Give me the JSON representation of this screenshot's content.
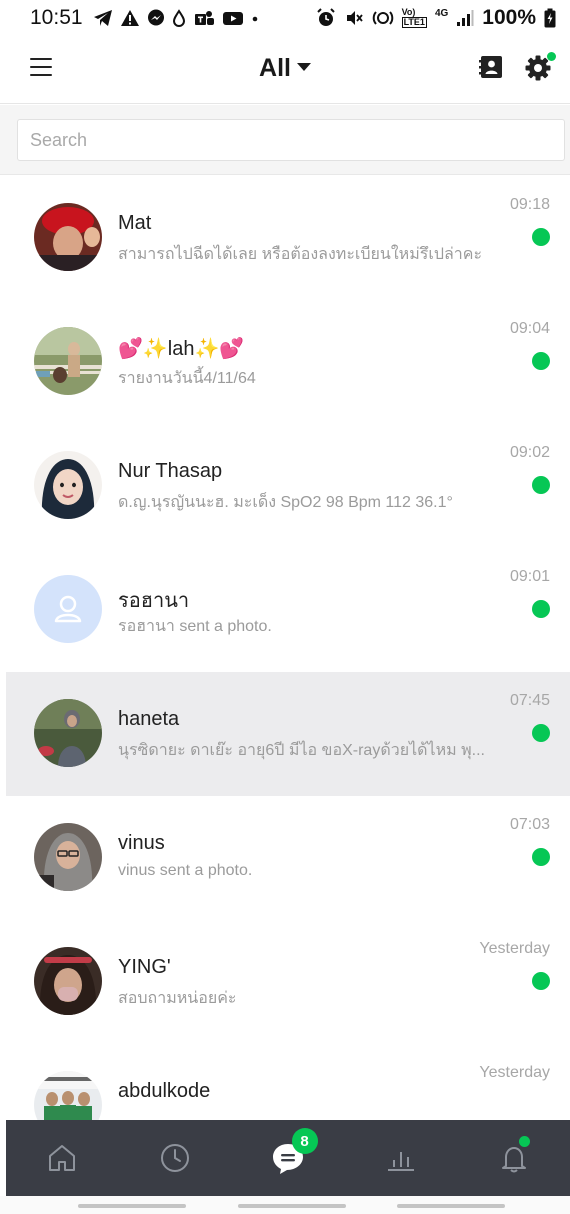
{
  "status_bar": {
    "time": "10:51",
    "left_icons": [
      "telegram-icon",
      "warning-icon",
      "messenger-icon",
      "drop-icon",
      "teams-icon",
      "youtube-icon",
      "dot-icon"
    ],
    "right_icons": [
      "alarm-icon",
      "mute-icon",
      "nfc-icon",
      "volte-icon",
      "signal-icon"
    ],
    "network_lte": "LTE1",
    "network_type": "4G",
    "battery": "100%"
  },
  "header": {
    "title": "All",
    "menu_icon": "hamburger-icon",
    "contacts_icon": "contacts-icon",
    "settings_icon": "gear-icon",
    "settings_has_dot": true
  },
  "search": {
    "placeholder": "Search",
    "value": ""
  },
  "chats": [
    {
      "name": "Mat",
      "preview": "สามารถไปฉีดได้เลย หรือต้องลงทะเบียนใหม่รึเปล่าคะ",
      "time": "09:18",
      "unread": true,
      "highlighted": false
    },
    {
      "name": "💕✨lah✨💕",
      "preview": "รายงานวันนี้4/11/64",
      "time": "09:04",
      "unread": true,
      "highlighted": false
    },
    {
      "name": "Nur Thasap",
      "preview": "ด.ญ.นุรญันนะฮ. มะเด็ง SpO2 98 Bpm 112 36.1°",
      "time": "09:02",
      "unread": true,
      "highlighted": false
    },
    {
      "name": "รอฮานา",
      "preview": "รอฮานา sent a photo.",
      "time": "09:01",
      "unread": true,
      "highlighted": false
    },
    {
      "name": "haneta",
      "preview": "นุรซิดายะ ดาเย๊ะ อายุ6ปี มีไอ ขอX-rayด้วยได้ไหม พุ...",
      "time": "07:45",
      "unread": true,
      "highlighted": true
    },
    {
      "name": "vinus",
      "preview": "vinus sent a photo.",
      "time": "07:03",
      "unread": true,
      "highlighted": false
    },
    {
      "name": "YING'",
      "preview": "สอบถามหน่อยค่ะ",
      "time": "Yesterday",
      "unread": true,
      "highlighted": false
    },
    {
      "name": "abdulkode",
      "preview": "",
      "time": "Yesterday",
      "unread": false,
      "highlighted": false
    }
  ],
  "bottom_nav": {
    "items": [
      {
        "icon": "home-icon"
      },
      {
        "icon": "clock-icon"
      },
      {
        "icon": "chat-icon",
        "badge": "8"
      },
      {
        "icon": "stats-icon"
      },
      {
        "icon": "bell-icon",
        "has_dot": true
      }
    ]
  },
  "colors": {
    "accent_green": "#06c755",
    "nav_background": "#3a3d45",
    "highlight_row": "#ececee"
  }
}
